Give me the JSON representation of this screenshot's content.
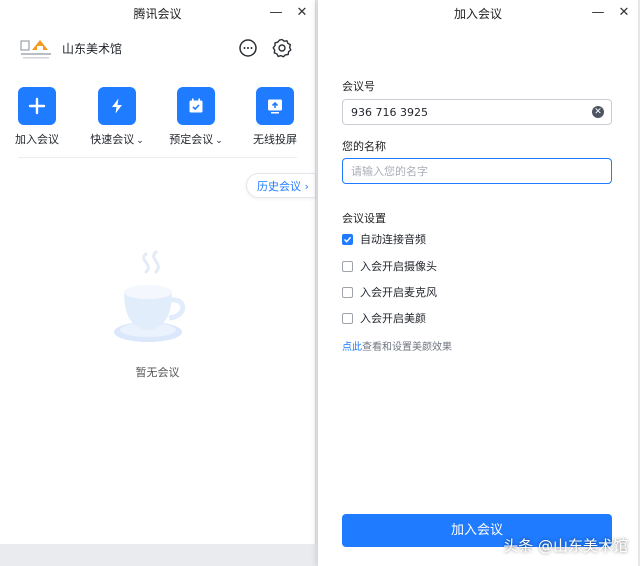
{
  "main_window": {
    "title": "腾讯会议",
    "profile": {
      "logo_icon": "gallery-logo-icon",
      "name": "山东美术馆"
    },
    "header_icons": [
      "chat-icon",
      "gear-icon"
    ],
    "actions": [
      {
        "label": "加入会议",
        "icon": "plus-icon",
        "has_dropdown": false
      },
      {
        "label": "快速会议",
        "icon": "lightning-icon",
        "has_dropdown": true
      },
      {
        "label": "预定会议",
        "icon": "calendar-check-icon",
        "has_dropdown": true
      },
      {
        "label": "无线投屏",
        "icon": "screen-cast-icon",
        "has_dropdown": false
      }
    ],
    "history_button": "历史会议",
    "empty_state": {
      "icon": "coffee-cup-icon",
      "text": "暂无会议"
    }
  },
  "join_window": {
    "title": "加入会议",
    "meeting_id": {
      "label": "会议号",
      "value": "936 716 3925"
    },
    "your_name": {
      "label": "您的名称",
      "value": "",
      "placeholder": "请输入您的名字"
    },
    "settings": {
      "label": "会议设置",
      "options": [
        {
          "label": "自动连接音频",
          "checked": true
        },
        {
          "label": "入会开启摄像头",
          "checked": false
        },
        {
          "label": "入会开启麦克风",
          "checked": false
        },
        {
          "label": "入会开启美颜",
          "checked": false
        }
      ]
    },
    "beauty_hint": {
      "link": "点此",
      "text": "查看和设置美颜效果"
    },
    "join_button": "加入会议"
  },
  "watermark": "头条 @山东美术馆",
  "colors": {
    "accent": "#1f7bff",
    "background": "#ffffff"
  }
}
